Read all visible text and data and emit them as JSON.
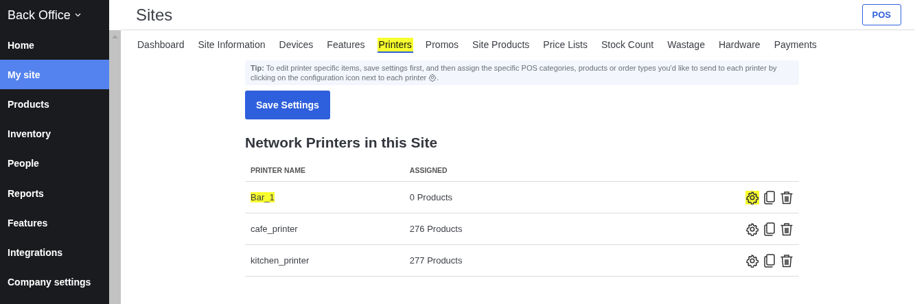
{
  "sidebar": {
    "title": "Back Office",
    "items": [
      {
        "label": "Home",
        "selected": false
      },
      {
        "label": "My site",
        "selected": true
      },
      {
        "label": "Products",
        "selected": false
      },
      {
        "label": "Inventory",
        "selected": false
      },
      {
        "label": "People",
        "selected": false
      },
      {
        "label": "Reports",
        "selected": false
      },
      {
        "label": "Features",
        "selected": false
      },
      {
        "label": "Integrations",
        "selected": false
      },
      {
        "label": "Company settings",
        "selected": false
      }
    ]
  },
  "page": {
    "title": "Sites",
    "pos_button": "POS"
  },
  "tabs": [
    {
      "label": "Dashboard",
      "selected": false,
      "highlighted": false
    },
    {
      "label": "Site Information",
      "selected": false,
      "highlighted": false
    },
    {
      "label": "Devices",
      "selected": false,
      "highlighted": false
    },
    {
      "label": "Features",
      "selected": false,
      "highlighted": false
    },
    {
      "label": "Printers",
      "selected": true,
      "highlighted": true
    },
    {
      "label": "Promos",
      "selected": false,
      "highlighted": false
    },
    {
      "label": "Site Products",
      "selected": false,
      "highlighted": false
    },
    {
      "label": "Price Lists",
      "selected": false,
      "highlighted": false
    },
    {
      "label": "Stock Count",
      "selected": false,
      "highlighted": false
    },
    {
      "label": "Wastage",
      "selected": false,
      "highlighted": false
    },
    {
      "label": "Hardware",
      "selected": false,
      "highlighted": false
    },
    {
      "label": "Payments",
      "selected": false,
      "highlighted": false
    }
  ],
  "tip": {
    "text": "**Tip:** To edit printer specific items, save settings first, and then assign the specific POS categories, products or order types you'd like to send to each printer by clicking on the configuration icon next to each printer",
    "end": "."
  },
  "save_button": "Save Settings",
  "section_title": "Network Printers in this Site",
  "table": {
    "columns": [
      "PRINTER NAME",
      "ASSIGNED"
    ],
    "rows": [
      {
        "name": "Bar_1",
        "assigned": "0 Products",
        "highlighted": true,
        "settings_highlighted": true
      },
      {
        "name": "cafe_printer",
        "assigned": "276 Products",
        "highlighted": false,
        "settings_highlighted": false
      },
      {
        "name": "kitchen_printer",
        "assigned": "277 Products",
        "highlighted": false,
        "settings_highlighted": false
      }
    ]
  }
}
